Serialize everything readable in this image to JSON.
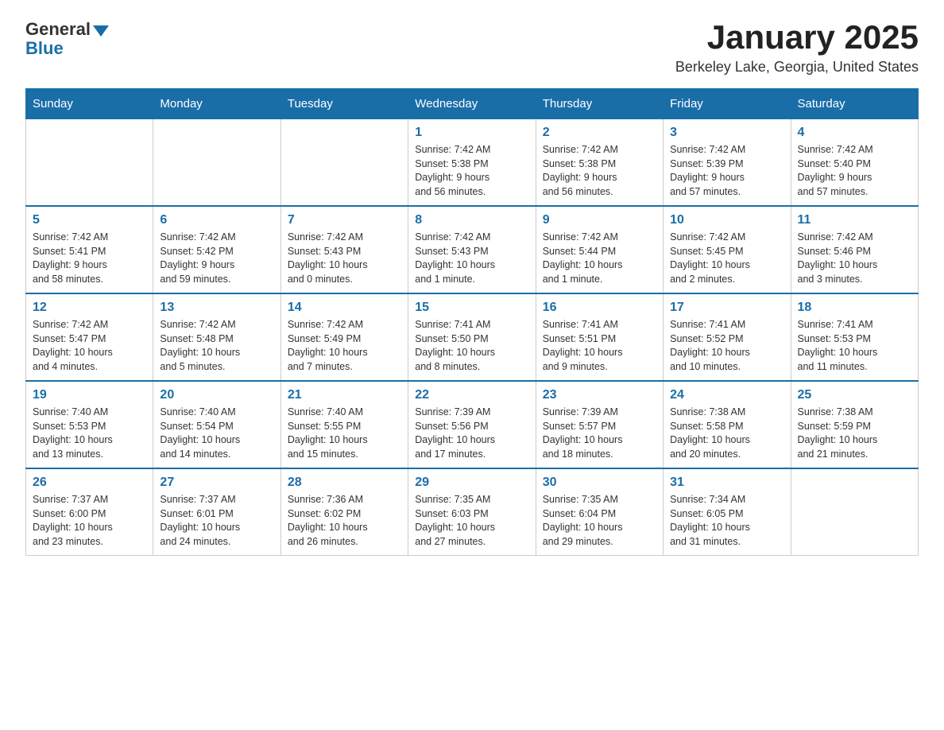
{
  "header": {
    "logo": {
      "general": "General",
      "blue": "Blue"
    },
    "title": "January 2025",
    "subtitle": "Berkeley Lake, Georgia, United States"
  },
  "weekdays": [
    "Sunday",
    "Monday",
    "Tuesday",
    "Wednesday",
    "Thursday",
    "Friday",
    "Saturday"
  ],
  "weeks": [
    [
      {
        "day": "",
        "info": ""
      },
      {
        "day": "",
        "info": ""
      },
      {
        "day": "",
        "info": ""
      },
      {
        "day": "1",
        "info": "Sunrise: 7:42 AM\nSunset: 5:38 PM\nDaylight: 9 hours\nand 56 minutes."
      },
      {
        "day": "2",
        "info": "Sunrise: 7:42 AM\nSunset: 5:38 PM\nDaylight: 9 hours\nand 56 minutes."
      },
      {
        "day": "3",
        "info": "Sunrise: 7:42 AM\nSunset: 5:39 PM\nDaylight: 9 hours\nand 57 minutes."
      },
      {
        "day": "4",
        "info": "Sunrise: 7:42 AM\nSunset: 5:40 PM\nDaylight: 9 hours\nand 57 minutes."
      }
    ],
    [
      {
        "day": "5",
        "info": "Sunrise: 7:42 AM\nSunset: 5:41 PM\nDaylight: 9 hours\nand 58 minutes."
      },
      {
        "day": "6",
        "info": "Sunrise: 7:42 AM\nSunset: 5:42 PM\nDaylight: 9 hours\nand 59 minutes."
      },
      {
        "day": "7",
        "info": "Sunrise: 7:42 AM\nSunset: 5:43 PM\nDaylight: 10 hours\nand 0 minutes."
      },
      {
        "day": "8",
        "info": "Sunrise: 7:42 AM\nSunset: 5:43 PM\nDaylight: 10 hours\nand 1 minute."
      },
      {
        "day": "9",
        "info": "Sunrise: 7:42 AM\nSunset: 5:44 PM\nDaylight: 10 hours\nand 1 minute."
      },
      {
        "day": "10",
        "info": "Sunrise: 7:42 AM\nSunset: 5:45 PM\nDaylight: 10 hours\nand 2 minutes."
      },
      {
        "day": "11",
        "info": "Sunrise: 7:42 AM\nSunset: 5:46 PM\nDaylight: 10 hours\nand 3 minutes."
      }
    ],
    [
      {
        "day": "12",
        "info": "Sunrise: 7:42 AM\nSunset: 5:47 PM\nDaylight: 10 hours\nand 4 minutes."
      },
      {
        "day": "13",
        "info": "Sunrise: 7:42 AM\nSunset: 5:48 PM\nDaylight: 10 hours\nand 5 minutes."
      },
      {
        "day": "14",
        "info": "Sunrise: 7:42 AM\nSunset: 5:49 PM\nDaylight: 10 hours\nand 7 minutes."
      },
      {
        "day": "15",
        "info": "Sunrise: 7:41 AM\nSunset: 5:50 PM\nDaylight: 10 hours\nand 8 minutes."
      },
      {
        "day": "16",
        "info": "Sunrise: 7:41 AM\nSunset: 5:51 PM\nDaylight: 10 hours\nand 9 minutes."
      },
      {
        "day": "17",
        "info": "Sunrise: 7:41 AM\nSunset: 5:52 PM\nDaylight: 10 hours\nand 10 minutes."
      },
      {
        "day": "18",
        "info": "Sunrise: 7:41 AM\nSunset: 5:53 PM\nDaylight: 10 hours\nand 11 minutes."
      }
    ],
    [
      {
        "day": "19",
        "info": "Sunrise: 7:40 AM\nSunset: 5:53 PM\nDaylight: 10 hours\nand 13 minutes."
      },
      {
        "day": "20",
        "info": "Sunrise: 7:40 AM\nSunset: 5:54 PM\nDaylight: 10 hours\nand 14 minutes."
      },
      {
        "day": "21",
        "info": "Sunrise: 7:40 AM\nSunset: 5:55 PM\nDaylight: 10 hours\nand 15 minutes."
      },
      {
        "day": "22",
        "info": "Sunrise: 7:39 AM\nSunset: 5:56 PM\nDaylight: 10 hours\nand 17 minutes."
      },
      {
        "day": "23",
        "info": "Sunrise: 7:39 AM\nSunset: 5:57 PM\nDaylight: 10 hours\nand 18 minutes."
      },
      {
        "day": "24",
        "info": "Sunrise: 7:38 AM\nSunset: 5:58 PM\nDaylight: 10 hours\nand 20 minutes."
      },
      {
        "day": "25",
        "info": "Sunrise: 7:38 AM\nSunset: 5:59 PM\nDaylight: 10 hours\nand 21 minutes."
      }
    ],
    [
      {
        "day": "26",
        "info": "Sunrise: 7:37 AM\nSunset: 6:00 PM\nDaylight: 10 hours\nand 23 minutes."
      },
      {
        "day": "27",
        "info": "Sunrise: 7:37 AM\nSunset: 6:01 PM\nDaylight: 10 hours\nand 24 minutes."
      },
      {
        "day": "28",
        "info": "Sunrise: 7:36 AM\nSunset: 6:02 PM\nDaylight: 10 hours\nand 26 minutes."
      },
      {
        "day": "29",
        "info": "Sunrise: 7:35 AM\nSunset: 6:03 PM\nDaylight: 10 hours\nand 27 minutes."
      },
      {
        "day": "30",
        "info": "Sunrise: 7:35 AM\nSunset: 6:04 PM\nDaylight: 10 hours\nand 29 minutes."
      },
      {
        "day": "31",
        "info": "Sunrise: 7:34 AM\nSunset: 6:05 PM\nDaylight: 10 hours\nand 31 minutes."
      },
      {
        "day": "",
        "info": ""
      }
    ]
  ]
}
